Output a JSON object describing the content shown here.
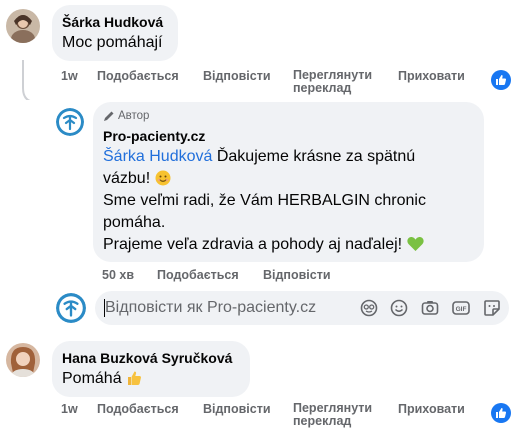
{
  "comment1": {
    "author": "Šárka Hudková",
    "text": "Moc pomáhají",
    "time": "1w",
    "like_label": "Подобається",
    "reply_label": "Відповісти",
    "translate_label_line1": "Переглянути",
    "translate_label_line2": "переклад",
    "hide_label": "Приховати"
  },
  "reply": {
    "author_tag": "Автор",
    "author": "Pro-pacienty.cz",
    "mention": "Šárka Hudková",
    "line1_rest": " Ďakujeme krásne za spätnú",
    "line2": "vázbu! ",
    "line3": "Sme veľmi radi, že Vám HERBALGIN chronic",
    "line4": "pomáha.",
    "line5": "Prajeme veľa zdravia a pohody aj naďalej! ",
    "time": "50 хв",
    "like_label": "Подобається",
    "reply_label": "Відповісти"
  },
  "reply_input": {
    "placeholder": "Відповісти як Pro-pacienty.cz",
    "icons": [
      "avatar-sticker-icon",
      "emoji-icon",
      "camera-icon",
      "gif-icon",
      "sticker-icon"
    ]
  },
  "comment2": {
    "author": "Hana Buzková Syručková",
    "text": "Pomáhá ",
    "time": "1w",
    "like_label": "Подобається",
    "reply_label": "Відповісти",
    "translate_label_line1": "Переглянути",
    "translate_label_line2": "переклад",
    "hide_label": "Приховати"
  },
  "colors": {
    "bubble": "#f0f2f5",
    "meta_text": "#65676b",
    "mention": "#216fdb",
    "like_blue": "#1877f2"
  }
}
